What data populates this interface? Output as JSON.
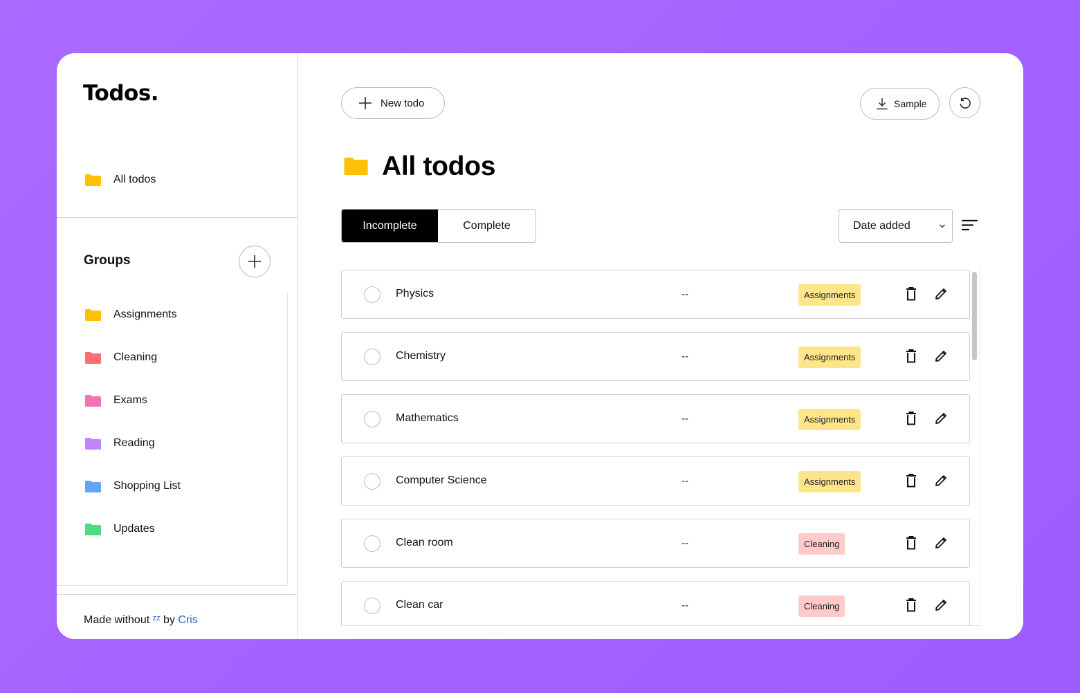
{
  "app": {
    "logo": "Todos."
  },
  "sidebar": {
    "all_todos": {
      "label": "All todos",
      "color": "#ffc107"
    },
    "groups_title": "Groups",
    "groups": [
      {
        "label": "Assignments",
        "color": "#ffc107"
      },
      {
        "label": "Cleaning",
        "color": "#f87171"
      },
      {
        "label": "Exams",
        "color": "#f472b6"
      },
      {
        "label": "Reading",
        "color": "#c084fc"
      },
      {
        "label": "Shopping List",
        "color": "#60a5fa"
      },
      {
        "label": "Updates",
        "color": "#4ade80"
      }
    ],
    "footer": {
      "prefix": "Made without ",
      "icon": "zz",
      "middle": " by ",
      "author": "Cris"
    }
  },
  "toolbar": {
    "new_todo_label": "New todo",
    "sample_label": "Sample",
    "refresh_icon": "refresh-icon"
  },
  "main": {
    "title": "All todos",
    "tabs": [
      {
        "label": "Incomplete",
        "active": true
      },
      {
        "label": "Complete",
        "active": false
      }
    ],
    "sort_select": {
      "value": "Date added"
    }
  },
  "todos": [
    {
      "title": "Physics",
      "date": "--",
      "group": "Assignments",
      "badge_color": "#fde68a"
    },
    {
      "title": "Chemistry",
      "date": "--",
      "group": "Assignments",
      "badge_color": "#fde68a"
    },
    {
      "title": "Mathematics",
      "date": "--",
      "group": "Assignments",
      "badge_color": "#fde68a"
    },
    {
      "title": "Computer Science",
      "date": "--",
      "group": "Assignments",
      "badge_color": "#fde68a"
    },
    {
      "title": "Clean room",
      "date": "--",
      "group": "Cleaning",
      "badge_color": "#fecaca"
    },
    {
      "title": "Clean car",
      "date": "--",
      "group": "Cleaning",
      "badge_color": "#fecaca"
    }
  ],
  "colors": {
    "background": "#a562ff",
    "accent": "#000000",
    "link": "#2f5fd0"
  }
}
